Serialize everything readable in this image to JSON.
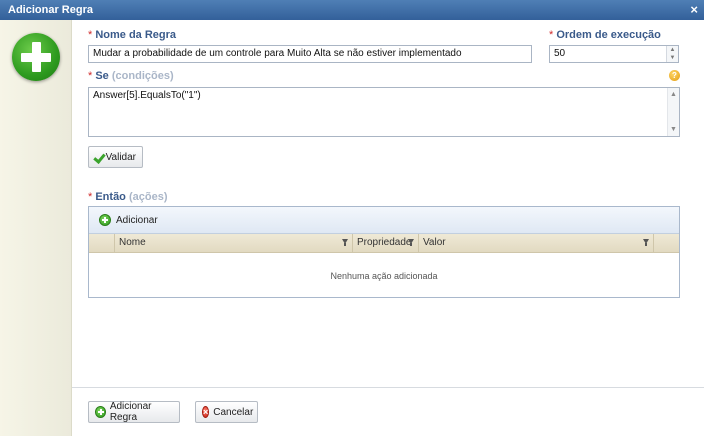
{
  "window": {
    "title": "Adicionar Regra",
    "close_glyph": "×"
  },
  "sidebar": {
    "icon": "green-plus-icon"
  },
  "form": {
    "rule_name": {
      "required_mark": "*",
      "label": "Nome da Regra",
      "value": "Mudar a probabilidade de um controle para Muito Alta se não estiver implementado"
    },
    "execution_order": {
      "required_mark": "*",
      "label": "Ordem de execução",
      "value": "50"
    },
    "conditions": {
      "required_mark": "*",
      "label": "Se",
      "hint": "(condições)",
      "value": "Answer[5].EqualsTo(\"1\")",
      "help_glyph": "?"
    },
    "validate_button": "Validar",
    "actions": {
      "required_mark": "*",
      "label": "Então",
      "hint": "(ações)",
      "toolbar_add": "Adicionar",
      "columns": [
        "Nome",
        "Propriedade",
        "Valor"
      ],
      "empty_message": "Nenhuma ação adicionada"
    }
  },
  "footer": {
    "add_rule_button": "Adicionar Regra",
    "cancel_button": "Cancelar"
  },
  "colors": {
    "titlebar": "#33609a",
    "label": "#3a5a8a",
    "required": "#d02a2a",
    "hint": "#aab6c8"
  }
}
